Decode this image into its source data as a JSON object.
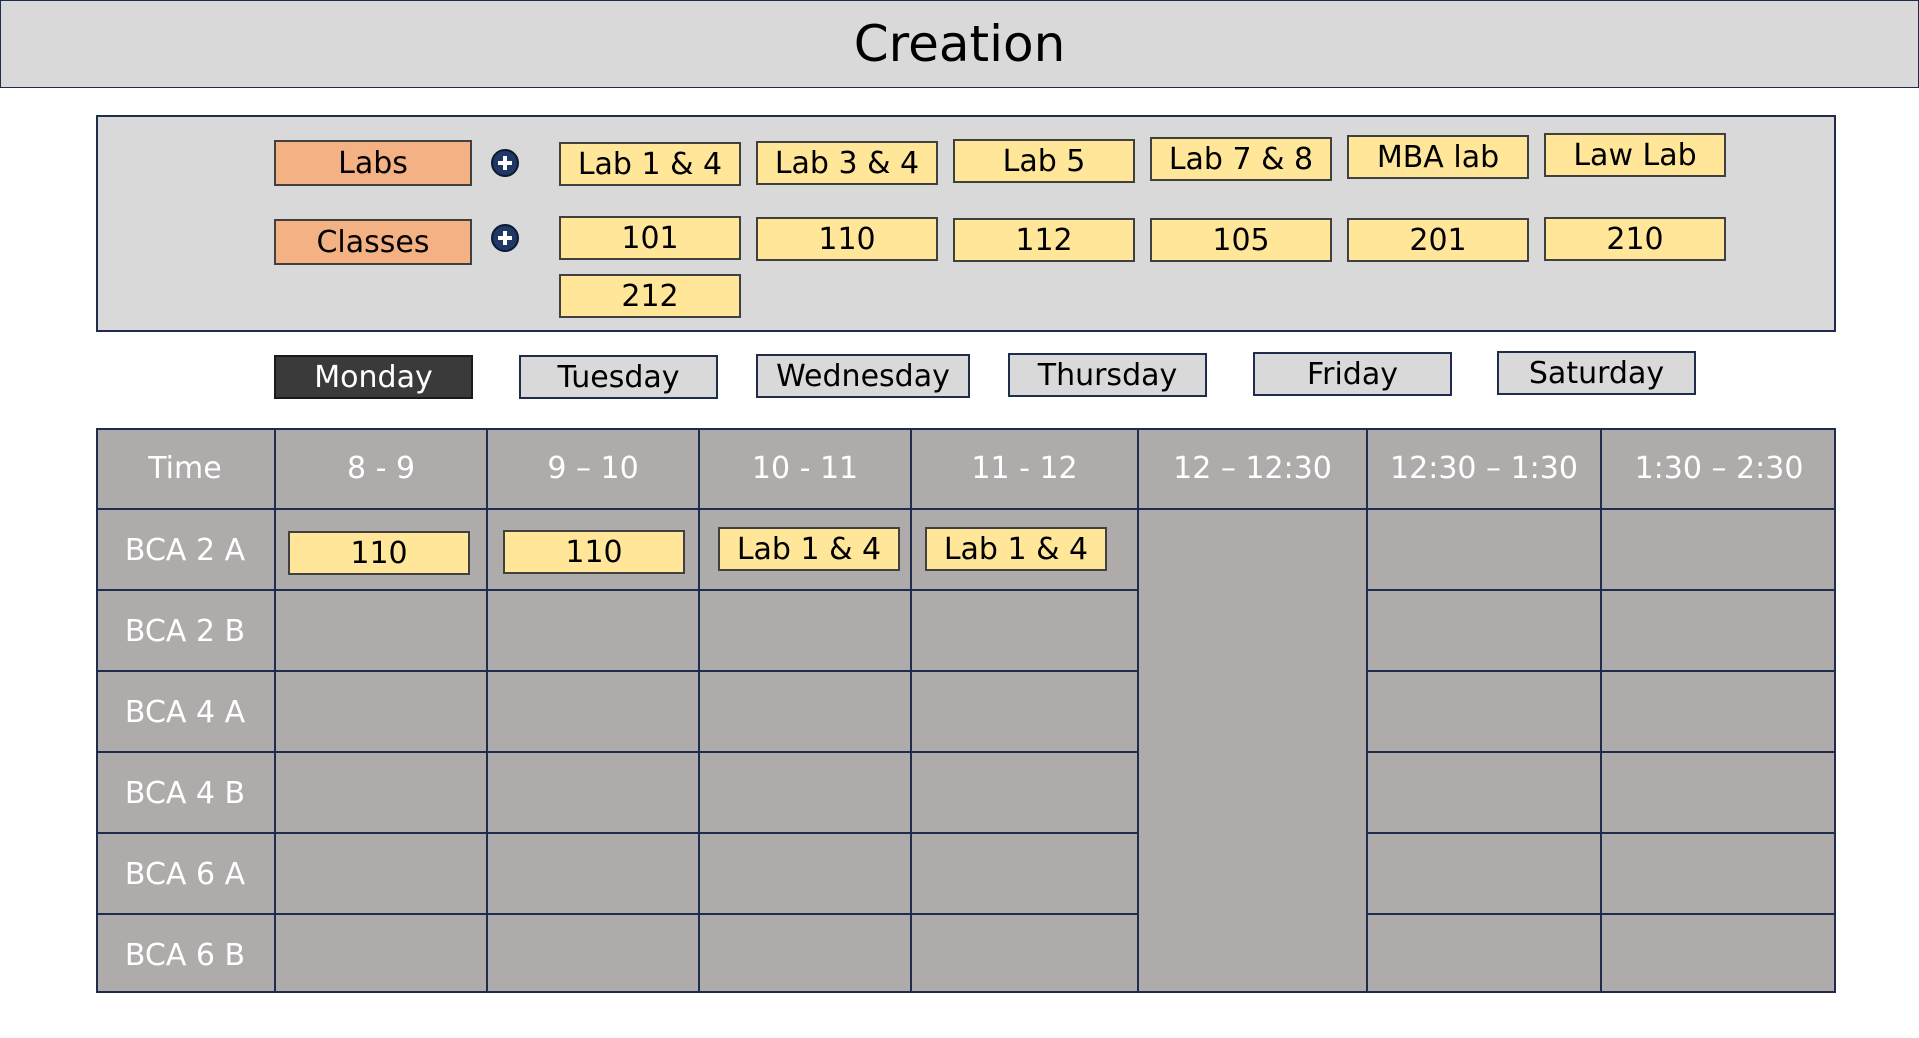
{
  "title": "Creation",
  "resources": {
    "labs": {
      "label": "Labs",
      "items": [
        "Lab 1 & 4",
        "Lab 3 & 4",
        "Lab 5",
        "Lab 7 & 8",
        "MBA lab",
        "Law Lab"
      ]
    },
    "classes": {
      "label": "Classes",
      "items": [
        "101",
        "110",
        "112",
        "105",
        "201",
        "210",
        "212"
      ]
    }
  },
  "days": {
    "selected": "Monday",
    "items": [
      "Monday",
      "Tuesday",
      "Wednesday",
      "Thursday",
      "Friday",
      "Saturday"
    ]
  },
  "timetable": {
    "corner_label": "Time",
    "slots": [
      "8 - 9",
      "9 – 10",
      "10 - 11",
      "11 - 12",
      "12 – 12:30",
      "12:30 – 1:30",
      "1:30 – 2:30"
    ],
    "rows": [
      {
        "label": "BCA 2 A",
        "assignments": [
          "110",
          "110",
          "Lab 1 & 4",
          "Lab 1 & 4"
        ]
      },
      {
        "label": "BCA 2 B",
        "assignments": []
      },
      {
        "label": "BCA 4 A",
        "assignments": []
      },
      {
        "label": "BCA 4 B",
        "assignments": []
      },
      {
        "label": "BCA 6 A",
        "assignments": []
      },
      {
        "label": "BCA 6 B",
        "assignments": []
      }
    ]
  },
  "colors": {
    "category_button": "#f4b183",
    "resource_chip": "#ffe699",
    "panel": "#d9d9d9",
    "grid": "#afabab",
    "border": "#1f2d4d",
    "active_tab": "#3a3a3a"
  }
}
